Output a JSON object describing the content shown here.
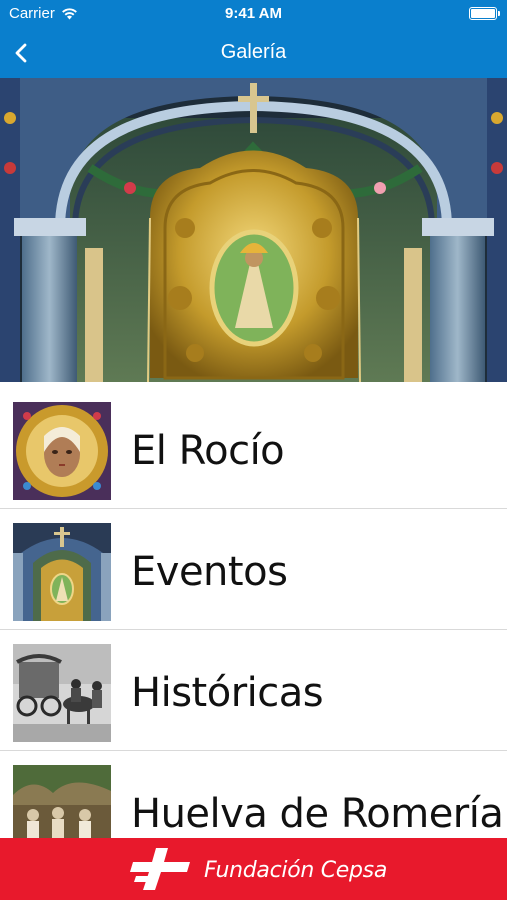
{
  "status_bar": {
    "carrier": "Carrier",
    "time": "9:41 AM"
  },
  "nav": {
    "title": "Galería"
  },
  "gallery": {
    "items": [
      {
        "label": "El Rocío",
        "thumb_icon": "virgin-face-photo"
      },
      {
        "label": "Eventos",
        "thumb_icon": "altar-photo"
      },
      {
        "label": "Históricas",
        "thumb_icon": "historic-carriage-photo"
      },
      {
        "label": "Huelva de Romería",
        "thumb_icon": "procession-photo"
      }
    ]
  },
  "footer": {
    "brand": "Fundación Cepsa"
  },
  "colors": {
    "nav": "#0a7fcd",
    "footer": "#e8192c"
  }
}
